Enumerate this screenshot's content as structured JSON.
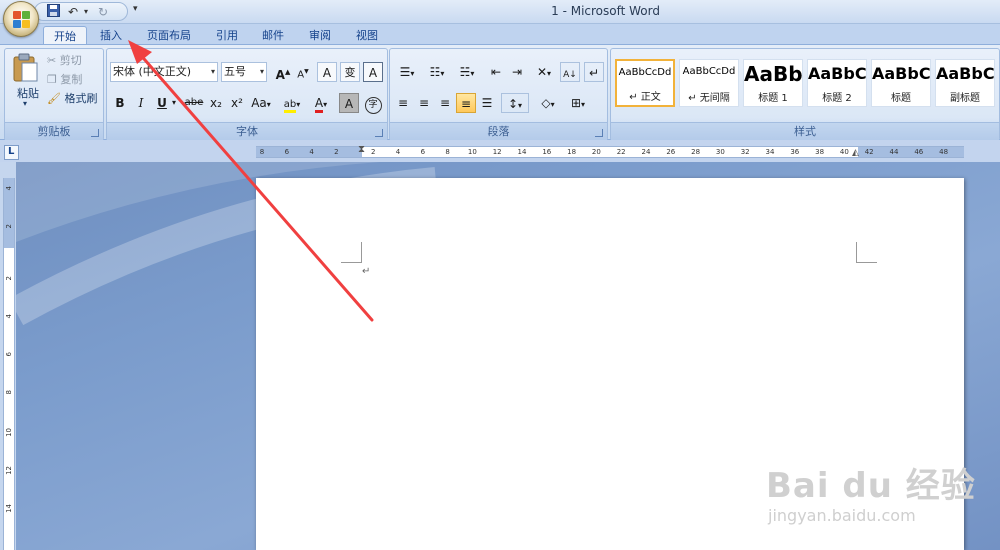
{
  "window": {
    "title": "1 - Microsoft Word"
  },
  "quick_access": {
    "save_icon": "save-icon",
    "undo_icon": "undo-icon",
    "redo_icon": "redo-icon",
    "customize_glyph": "▾"
  },
  "tabs": [
    {
      "label": "开始",
      "active": true
    },
    {
      "label": "插入",
      "active": false
    },
    {
      "label": "页面布局",
      "active": false
    },
    {
      "label": "引用",
      "active": false
    },
    {
      "label": "邮件",
      "active": false
    },
    {
      "label": "审阅",
      "active": false
    },
    {
      "label": "视图",
      "active": false
    }
  ],
  "clipboard": {
    "group_label": "剪贴板",
    "paste_label": "粘贴",
    "cut_label": "剪切",
    "copy_label": "复制",
    "format_painter_label": "格式刷"
  },
  "font": {
    "group_label": "字体",
    "font_name": "宋体 (中文正文)",
    "font_size": "五号",
    "grow_label": "A",
    "shrink_label": "A",
    "clear_label": "A",
    "pinyin_label": "变",
    "border_label": "A",
    "bold_label": "B",
    "italic_label": "I",
    "underline_label": "U",
    "strike_label": "abe",
    "subscript_label": "x₂",
    "superscript_label": "x²",
    "case_label": "Aa",
    "highlight_label": "ab",
    "color_label": "A",
    "shading_label": "A",
    "enclose_label": "字"
  },
  "paragraph": {
    "group_label": "段落"
  },
  "styles": {
    "group_label": "样式",
    "items": [
      {
        "sample": "AaBbCcDd",
        "name": "↵ 正文",
        "selected": true
      },
      {
        "sample": "AaBbCcDd",
        "name": "↵ 无间隔",
        "selected": false
      },
      {
        "sample": "AaBb",
        "name": "标题 1",
        "selected": false
      },
      {
        "sample": "AaBbC",
        "name": "标题 2",
        "selected": false
      },
      {
        "sample": "AaBbC",
        "name": "标题",
        "selected": false
      },
      {
        "sample": "AaBbC",
        "name": "副标题",
        "selected": false
      }
    ]
  },
  "ruler": {
    "corner_label": "L",
    "h_ticks": [
      "8",
      "6",
      "4",
      "2",
      "2",
      "4",
      "6",
      "8",
      "10",
      "12",
      "14",
      "16",
      "18",
      "20",
      "22",
      "24",
      "26",
      "28",
      "30",
      "32",
      "34",
      "36",
      "38",
      "40",
      "42",
      "44",
      "46",
      "48"
    ],
    "v_ticks": [
      "4",
      "2",
      "2",
      "4",
      "6",
      "8",
      "10",
      "12",
      "14"
    ]
  },
  "document": {
    "paragraph_mark": "↵"
  },
  "watermark": {
    "main": "Bai du 经验",
    "url": "jingyan.baidu.com"
  },
  "colors": {
    "arrow": "#f04040",
    "accent": "#15428b"
  }
}
